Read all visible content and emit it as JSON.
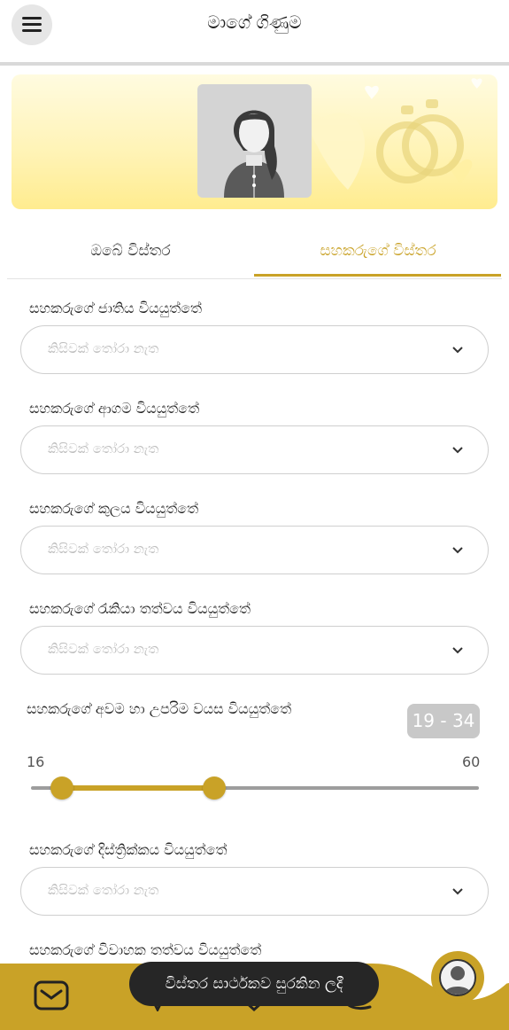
{
  "header": {
    "title": "මාගේ ගිණුම",
    "menu_icon": "hamburger-menu-icon"
  },
  "banner": {
    "avatar_icon": "female-user-avatar-icon",
    "decoration_icon": "wedding-rings-hearts-icon"
  },
  "tabs": [
    {
      "label": "ඔබේ විස්තර",
      "active": false
    },
    {
      "label": "සහකරුගේ විස්තර",
      "active": true
    }
  ],
  "form": {
    "fields": [
      {
        "label": "සහකරුගේ ජාතිය වියයුත්තේ",
        "placeholder": "කිසිවක් තෝරා නැත"
      },
      {
        "label": "සහකරුගේ ආගම වියයුත්තේ",
        "placeholder": "කිසිවක් තෝරා නැත"
      },
      {
        "label": "සහකරුගේ කුලය වියයුත්තේ",
        "placeholder": "කිසිවක් තෝරා නැත"
      },
      {
        "label": "සහකරුගේ රැකියා තත්වය වියයුත්තේ",
        "placeholder": "කිසිවක් තෝරා නැත"
      }
    ],
    "age": {
      "label": "සහකරුගේ අවම හා උපරිම වයස වියයුත්තේ",
      "badge": "19 - 34",
      "range_min_label": "16",
      "range_max_label": "60",
      "scale_min": 16,
      "scale_max": 60,
      "selected_min": 19,
      "selected_max": 34
    },
    "district": {
      "label": "සහකරුගේ දිස්ත්‍රික්කය වියයුත්තේ",
      "placeholder": "කිසිවක් තෝරා නැත"
    },
    "marital": {
      "label": "සහකරුගේ විවාහක තත්වය වියයුත්තේ"
    }
  },
  "toast": {
    "text": "විස්තර සාර්ථකව සුරකින ලදී"
  },
  "bottom_nav": {
    "accent_color": "#c9a227",
    "items": [
      "mail-icon",
      "home-icon",
      "chat-icon"
    ],
    "profile_icon": "profile-icon"
  },
  "colors": {
    "accent": "#c9a227",
    "badge_bg": "#c8c8c8",
    "toast_bg": "#262626"
  }
}
